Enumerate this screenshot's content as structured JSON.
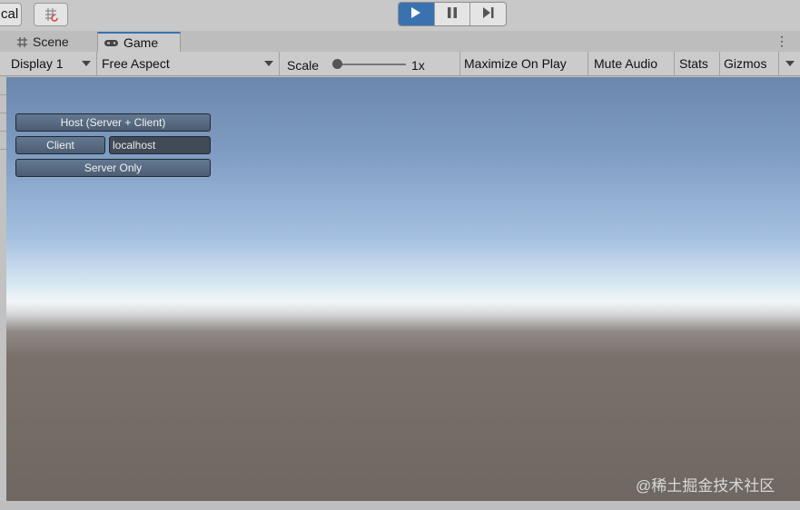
{
  "toolbar": {
    "local_label": "cal",
    "play_buttons": [
      {
        "name": "play",
        "icon": "play-icon",
        "active": true
      },
      {
        "name": "pause",
        "icon": "pause-icon",
        "active": false
      },
      {
        "name": "step",
        "icon": "step-icon",
        "active": false
      }
    ]
  },
  "tabs": {
    "scene": {
      "label": "Scene",
      "icon": "grid-icon"
    },
    "game": {
      "label": "Game",
      "icon": "gamepad-icon",
      "selected": true
    }
  },
  "game_toolbar": {
    "display": "Display 1",
    "aspect": "Free Aspect",
    "scale_label": "Scale",
    "scale_value": "1x",
    "maximize": "Maximize On Play",
    "mute": "Mute Audio",
    "stats": "Stats",
    "gizmos": "Gizmos"
  },
  "network_gui": {
    "host_button": "Host (Server + Client)",
    "client_button": "Client",
    "address_field": "localhost",
    "server_button": "Server Only"
  },
  "watermark": "@稀土掘金技术社区",
  "colors": {
    "accent": "#3a72b0",
    "gui_button": "#566a80"
  }
}
